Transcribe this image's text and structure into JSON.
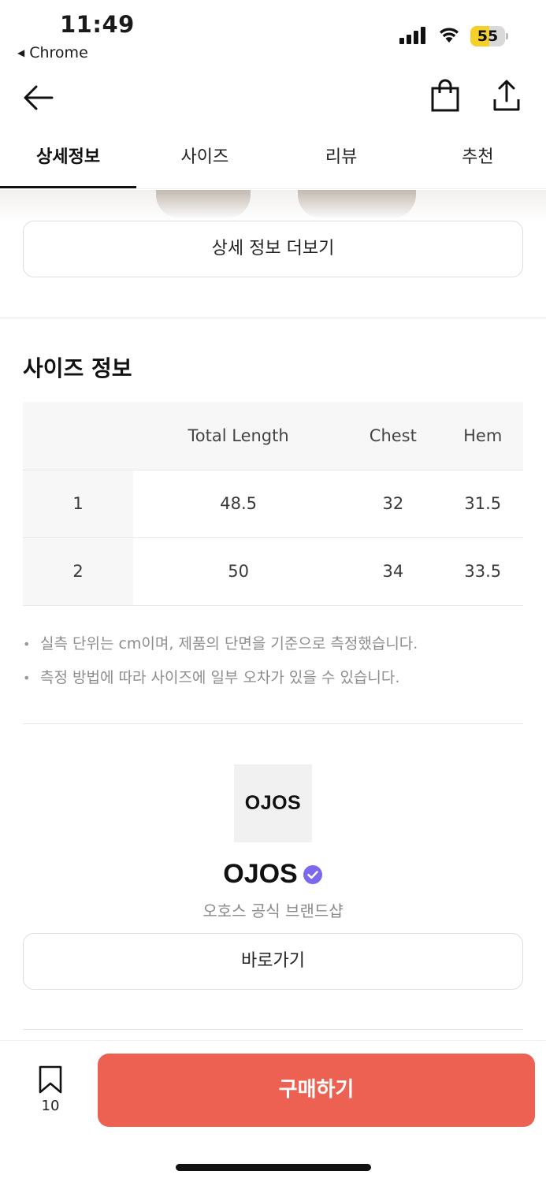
{
  "status_bar": {
    "time": "11:49",
    "back_app": "Chrome",
    "battery_level": "55",
    "battery_fraction": 0.55,
    "battery_color": "#f5cf2a"
  },
  "nav": {
    "back_icon": "arrow-left-icon",
    "bag_icon": "shopping-bag-icon",
    "share_icon": "share-icon"
  },
  "tabs": [
    {
      "label": "상세정보",
      "active": true
    },
    {
      "label": "사이즈",
      "active": false
    },
    {
      "label": "리뷰",
      "active": false
    },
    {
      "label": "추천",
      "active": false
    }
  ],
  "detail": {
    "more_button": "상세 정보 더보기"
  },
  "size_info": {
    "title": "사이즈 정보",
    "columns": [
      "",
      "Total Length",
      "Chest",
      "Hem"
    ],
    "rows": [
      [
        "1",
        "48.5",
        "32",
        "31.5"
      ],
      [
        "2",
        "50",
        "34",
        "33.5"
      ]
    ],
    "notes": [
      "실측 단위는 cm이며, 제품의 단면을 기준으로 측정했습니다.",
      "측정 방법에 따라 사이즈에 일부 오차가 있을 수 있습니다."
    ]
  },
  "brand": {
    "logo_text": "OJOS",
    "name": "OJOS",
    "verified_icon": "verified-badge-icon",
    "verified_color": "#7b68ee",
    "subtitle": "오호스 공식 브랜드샵",
    "go_button": "바로가기"
  },
  "bottom_bar": {
    "bookmark_icon": "bookmark-icon",
    "bookmark_count": "10",
    "buy_button": "구매하기",
    "buy_color": "#ed6152"
  }
}
